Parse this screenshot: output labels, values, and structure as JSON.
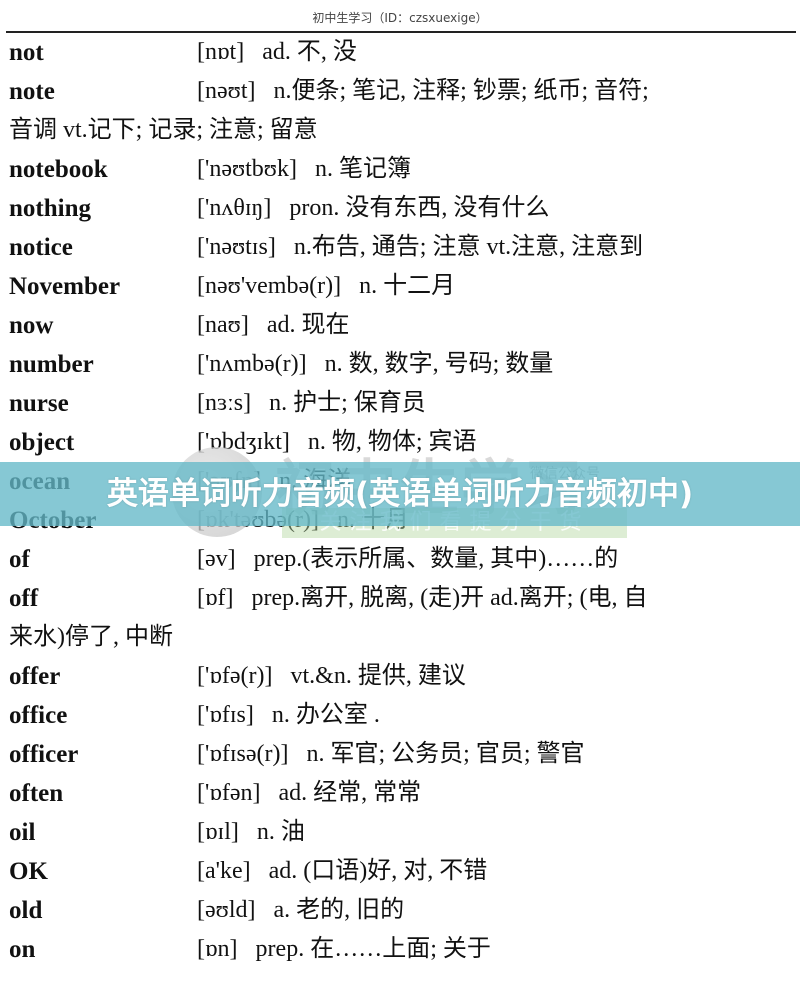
{
  "header": {
    "source": "初中生学习（ID：czsxuexige）"
  },
  "banner": {
    "title": "英语单词听力音频(英语单词听力音频初中)",
    "color": "#64b9c8"
  },
  "watermark": {
    "title": "初中生学习",
    "subtitle": "微信公众号",
    "slogan": "关注我们看提分干货"
  },
  "entries": [
    {
      "word": "not",
      "phonetic": "[nɒt]",
      "definition": "ad. 不, 没"
    },
    {
      "word": "note",
      "phonetic": "[nəʊt]",
      "definition": "n.便条; 笔记, 注释; 钞票; 纸币; 音符;",
      "continuation": "音调  vt.记下; 记录; 注意; 留意"
    },
    {
      "word": "notebook",
      "phonetic": "['nəʊtbʊk]",
      "definition": "n.  笔记簿"
    },
    {
      "word": "nothing",
      "phonetic": "['nʌθɪŋ]",
      "definition": "pron.  没有东西, 没有什么"
    },
    {
      "word": "notice",
      "phonetic": "['nəʊtɪs]",
      "definition": "n.布告, 通告; 注意  vt.注意, 注意到"
    },
    {
      "word": "November",
      "phonetic": "[nəʊ'vembə(r)]",
      "definition": "n.  十二月"
    },
    {
      "word": "now",
      "phonetic": "[naʊ]",
      "definition": "ad.  现在"
    },
    {
      "word": "number",
      "phonetic": "['nʌmbə(r)]",
      "definition": "n.  数, 数字, 号码; 数量"
    },
    {
      "word": "nurse",
      "phonetic": "[nɜːs]",
      "definition": "n.  护士; 保育员"
    },
    {
      "word": "object",
      "phonetic": "['ɒbdʒɪkt]",
      "definition": "n.  物, 物体; 宾语"
    },
    {
      "word": "ocean",
      "phonetic": "['əʊʃn]",
      "definition": "n.  海洋"
    },
    {
      "word": "October",
      "phonetic": "[ɒk'təʊbə(r)]",
      "definition": "n.  十月"
    },
    {
      "word": "of",
      "phonetic": "[əv]",
      "definition": "prep.(表示所属、数量, 其中)……的"
    },
    {
      "word": "off",
      "phonetic": "[ɒf]",
      "definition": "prep.离开, 脱离, (走)开  ad.离开; (电, 自",
      "continuation": "来水)停了, 中断"
    },
    {
      "word": "offer",
      "phonetic": "['ɒfə(r)]",
      "definition": "vt.&n.  提供, 建议"
    },
    {
      "word": "office",
      "phonetic": "['ɒfɪs]",
      "definition": "n.  办公室  ."
    },
    {
      "word": "officer",
      "phonetic": "['ɒfɪsə(r)]",
      "definition": "n.  军官; 公务员; 官员; 警官"
    },
    {
      "word": "often",
      "phonetic": "['ɒfən]",
      "definition": "ad.  经常, 常常"
    },
    {
      "word": "oil",
      "phonetic": "[ɒɪl]",
      "definition": "n.  油"
    },
    {
      "word": "OK",
      "phonetic": "[a'ke]",
      "definition": "ad. (口语)好, 对, 不错"
    },
    {
      "word": "old",
      "phonetic": "[əʊld]",
      "definition": "a.  老的, 旧的"
    },
    {
      "word": "on",
      "phonetic": "[ɒn]",
      "definition": "prep.  在……上面; 关于"
    }
  ]
}
